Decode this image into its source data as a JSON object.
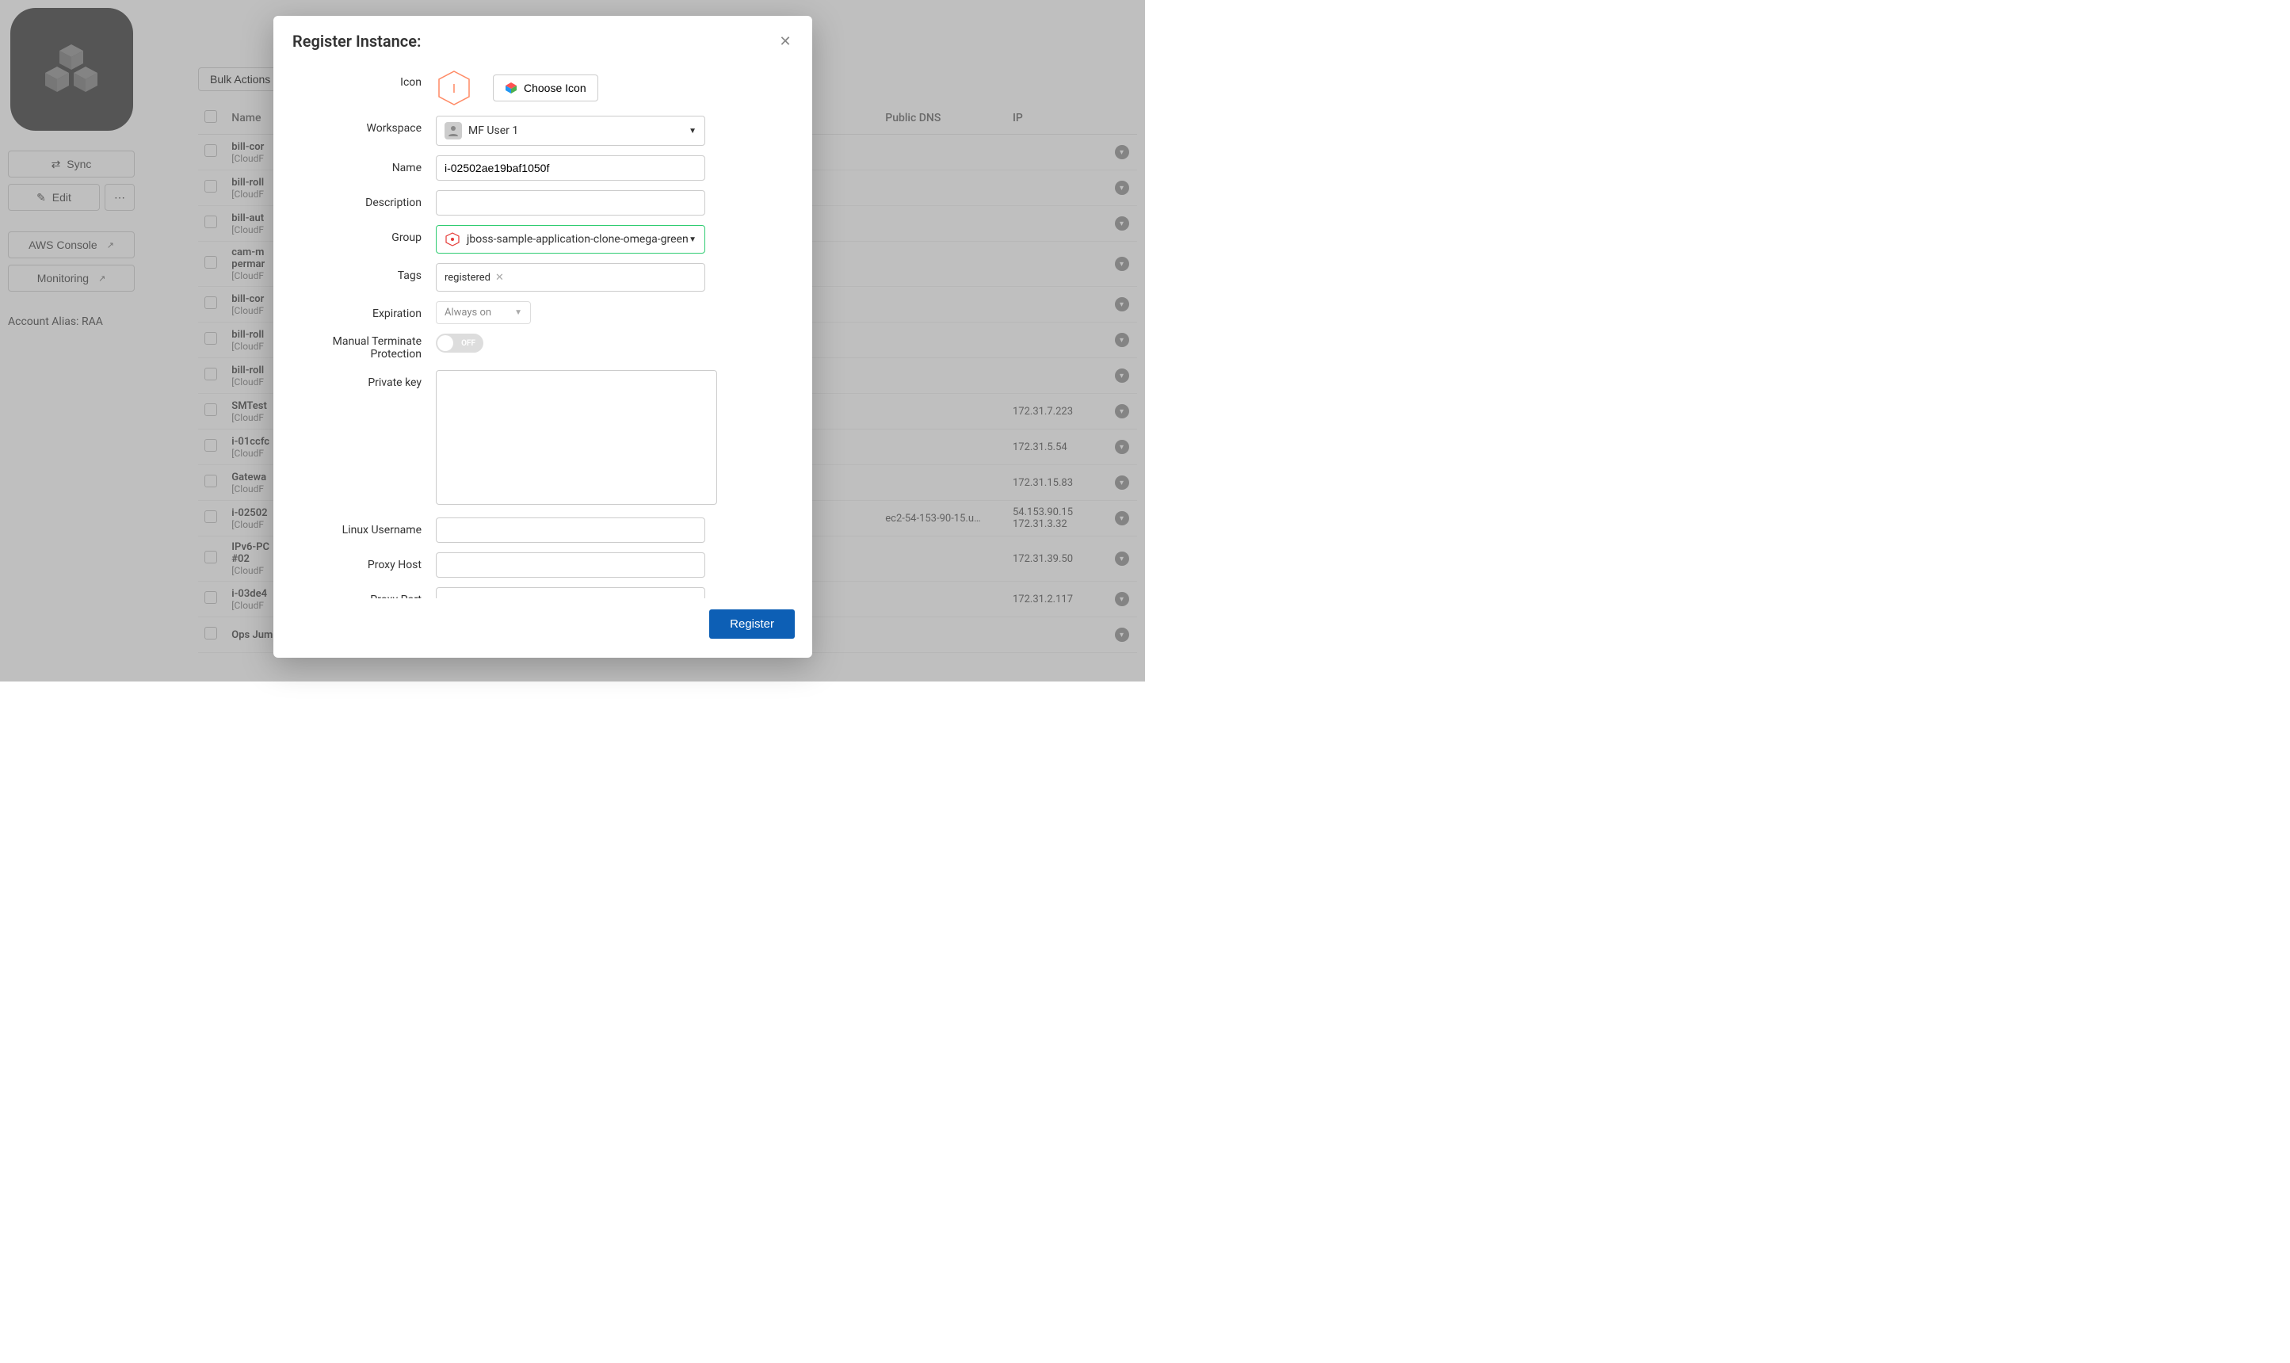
{
  "sidebar": {
    "sync_label": "Sync",
    "edit_label": "Edit",
    "aws_console_label": "AWS Console",
    "monitoring_label": "Monitoring",
    "account_alias_label": "Account Alias:",
    "account_alias_value": "RAA"
  },
  "toolbar": {
    "bulk_actions_label": "Bulk Actions"
  },
  "table": {
    "headers": {
      "name": "Name",
      "public_dns": "Public DNS",
      "ip": "IP"
    },
    "rows": [
      {
        "name": "bill-cor",
        "sub": "[CloudF",
        "dns": "",
        "ip": ""
      },
      {
        "name": "bill-roll",
        "sub": "[CloudF",
        "dns": "",
        "ip": ""
      },
      {
        "name": "bill-aut",
        "sub": "[CloudF",
        "dns": "",
        "ip": ""
      },
      {
        "name": "cam-m\npermar",
        "sub": "[CloudF",
        "dns": "",
        "ip": ""
      },
      {
        "name": "bill-cor",
        "sub": "[CloudF",
        "dns": "",
        "ip": ""
      },
      {
        "name": "bill-roll",
        "sub": "[CloudF",
        "dns": "",
        "ip": ""
      },
      {
        "name": "bill-roll",
        "sub": "[CloudF",
        "dns": "",
        "ip": ""
      },
      {
        "name": "SMTest",
        "sub": "[CloudF",
        "dns": "",
        "ip": "172.31.7.223"
      },
      {
        "name": "i-01ccfc",
        "sub": "[CloudF",
        "dns": "",
        "ip": "172.31.5.54"
      },
      {
        "name": "Gatewa",
        "sub": "[CloudF",
        "dns": "",
        "ip": "172.31.15.83"
      },
      {
        "name": "i-02502",
        "sub": "[CloudF",
        "dns": "ec2-54-153-90-15.u…",
        "ip": "54.153.90.15\n172.31.3.32"
      },
      {
        "name": "IPv6-PC\n#02",
        "sub": "[CloudF",
        "dns": "",
        "ip": "172.31.39.50"
      },
      {
        "name": "i-03de4",
        "sub": "[CloudF",
        "dns": "",
        "ip": "172.31.2.117"
      },
      {
        "name": "Ops Jump Box",
        "sub": "",
        "dns": "",
        "ip": ""
      }
    ]
  },
  "modal": {
    "title": "Register Instance:",
    "labels": {
      "icon": "Icon",
      "choose_icon": "Choose Icon",
      "workspace": "Workspace",
      "name": "Name",
      "description": "Description",
      "group": "Group",
      "tags": "Tags",
      "expiration": "Expiration",
      "manual_terminate": "Manual Terminate Protection",
      "private_key": "Private key",
      "linux_username": "Linux Username",
      "proxy_host": "Proxy Host",
      "proxy_port": "Proxy Port",
      "register_button": "Register"
    },
    "values": {
      "icon_letter": "I",
      "workspace": "MF User 1",
      "name": "i-02502ae19baf1050f",
      "description": "",
      "group": "jboss-sample-application-clone-omega-green",
      "tags": [
        "registered"
      ],
      "expiration": "Always on",
      "manual_terminate": "OFF",
      "private_key": "",
      "linux_username": "",
      "proxy_host": "",
      "proxy_port": ""
    }
  }
}
